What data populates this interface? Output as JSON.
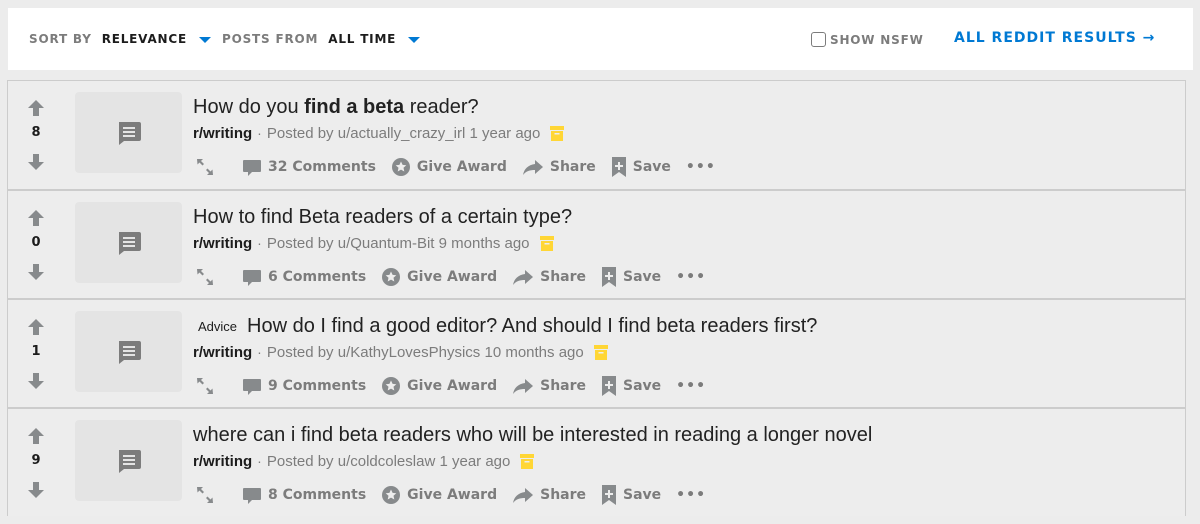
{
  "toolbar": {
    "sort_label": "SORT BY",
    "sort_value": "RELEVANCE",
    "from_label": "POSTS FROM",
    "from_value": "ALL TIME",
    "nsfw_label": "SHOW NSFW",
    "nsfw_checked": false,
    "all_results_label": "ALL REDDIT RESULTS →"
  },
  "colors": {
    "accent": "#0079d3",
    "archive": "#ffd635",
    "icon_gray": "#7c7c7c"
  },
  "posts": [
    {
      "score": "8",
      "flair": "",
      "title_pre": "How do you ",
      "title_bold": "find a beta",
      "title_post": " reader?",
      "subreddit": "r/writing",
      "posted_by": "Posted by",
      "user": "u/actually_crazy_irl",
      "age": "1 year ago",
      "comments": "32 Comments",
      "award": "Give Award",
      "share": "Share",
      "save": "Save",
      "more": "•••"
    },
    {
      "score": "0",
      "flair": "",
      "title_pre": "How to find Beta readers of a certain type?",
      "title_bold": "",
      "title_post": "",
      "subreddit": "r/writing",
      "posted_by": "Posted by",
      "user": "u/Quantum-Bit",
      "age": "9 months ago",
      "comments": "6 Comments",
      "award": "Give Award",
      "share": "Share",
      "save": "Save",
      "more": "•••"
    },
    {
      "score": "1",
      "flair": "Advice",
      "title_pre": "How do I find a good editor? And should I find beta readers first?",
      "title_bold": "",
      "title_post": "",
      "subreddit": "r/writing",
      "posted_by": "Posted by",
      "user": "u/KathyLovesPhysics",
      "age": "10 months ago",
      "comments": "9 Comments",
      "award": "Give Award",
      "share": "Share",
      "save": "Save",
      "more": "•••"
    },
    {
      "score": "9",
      "flair": "",
      "title_pre": "where can i find beta readers who will be interested in reading a longer novel",
      "title_bold": "",
      "title_post": "",
      "subreddit": "r/writing",
      "posted_by": "Posted by",
      "user": "u/coldcoleslaw",
      "age": "1 year ago",
      "comments": "8 Comments",
      "award": "Give Award",
      "share": "Share",
      "save": "Save",
      "more": "•••"
    }
  ]
}
